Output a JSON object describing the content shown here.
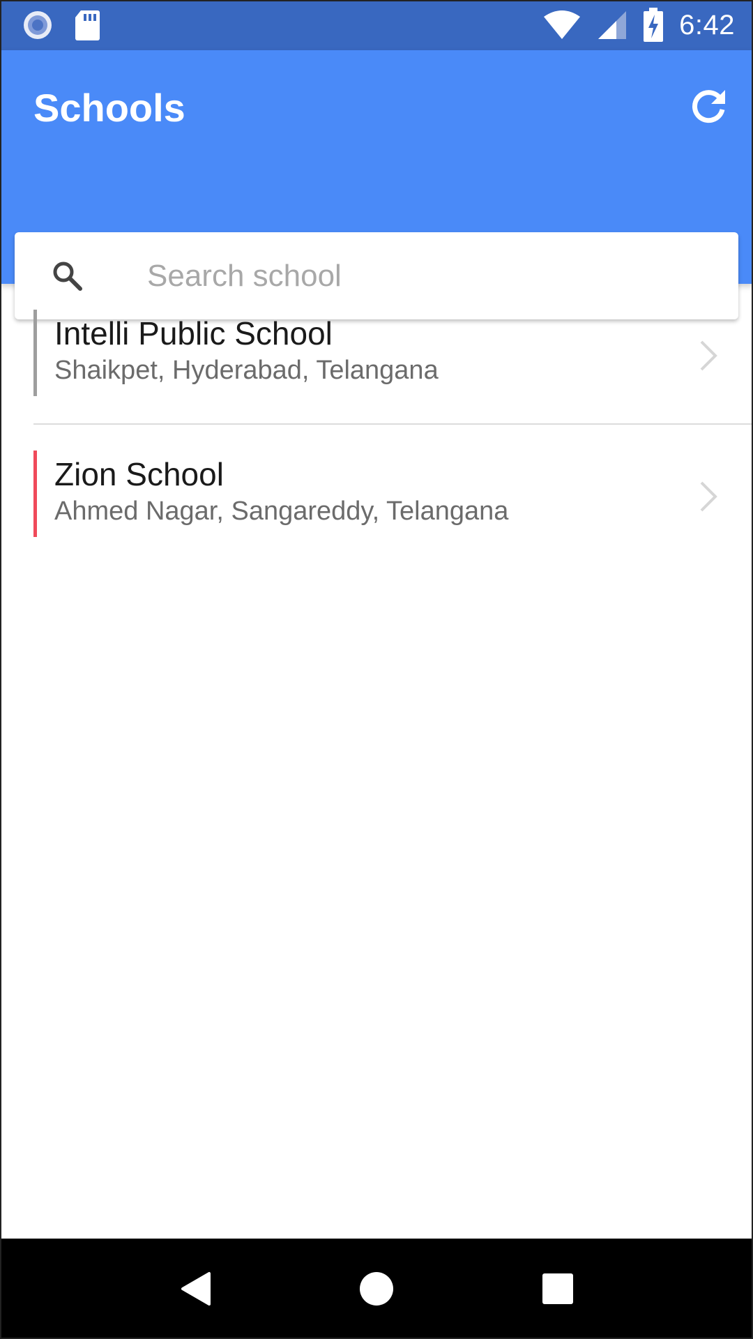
{
  "status_bar": {
    "time": "6:42",
    "icons": [
      "notification-icon",
      "sd-card-icon",
      "wifi-icon",
      "cell-signal-icon",
      "battery-charging-icon"
    ]
  },
  "app_bar": {
    "title": "Schools",
    "refresh_icon": "refresh-icon",
    "background": "#4a8af8"
  },
  "search": {
    "placeholder": "Search school",
    "value": "",
    "icon": "search-icon"
  },
  "schools": [
    {
      "name": "Intelli Public School",
      "location": "Shaikpet, Hyderabad, Telangana",
      "accent_color": "#9e9e9e"
    },
    {
      "name": "Zion School",
      "location": "Ahmed Nagar, Sangareddy, Telangana",
      "accent_color": "#f04a5a"
    }
  ],
  "nav_bar": {
    "buttons": [
      "back-icon",
      "home-icon",
      "recents-icon"
    ]
  }
}
